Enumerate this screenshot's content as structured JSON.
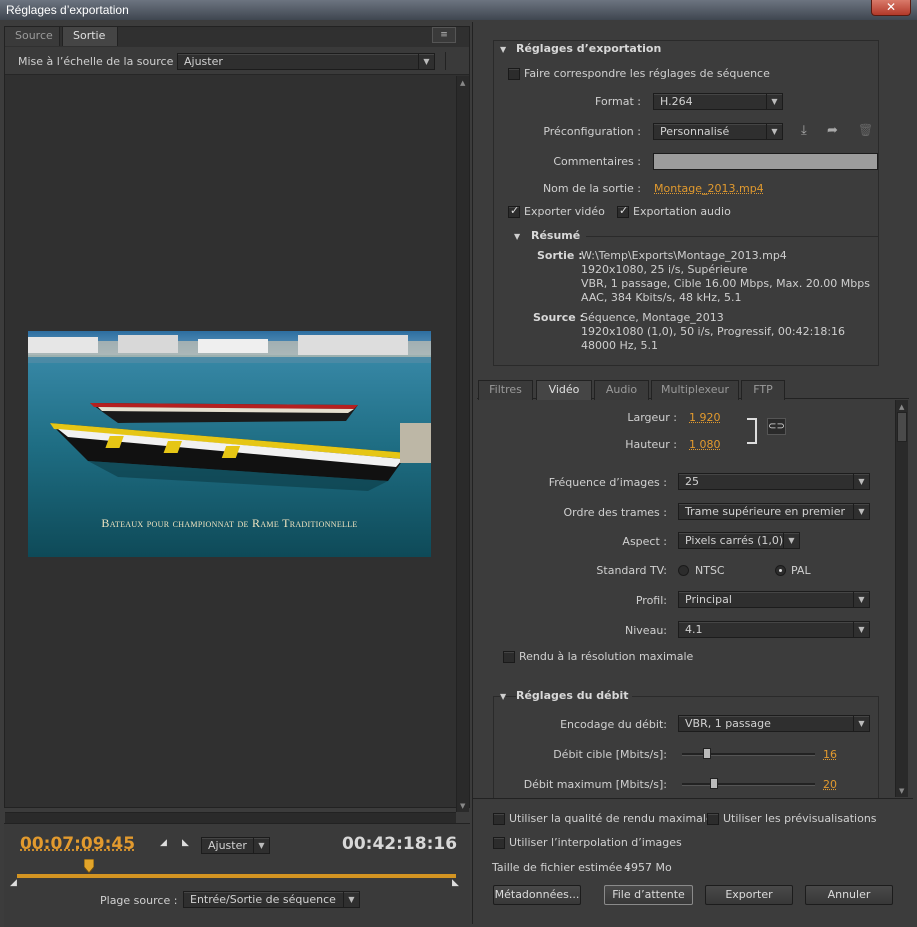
{
  "window": {
    "title": "Réglages d’exportation",
    "close": "✕"
  },
  "left": {
    "tabs": [
      "Source",
      "Sortie"
    ],
    "menu_icon": "≡",
    "scale_label": "Mise à l’échelle de la source :",
    "scale_value": "Ajuster",
    "caption": "Bateaux pour championnat de Rame Traditionnelle",
    "timecode_current": "00:07:09:45",
    "timecode_total": "00:42:18:16",
    "fit_value": "Ajuster",
    "range_label": "Plage source :",
    "range_value": "Entrée/Sortie de séquence",
    "playhead_fraction": 0.165
  },
  "export": {
    "section_title": "Réglages d’exportation",
    "match_seq": "Faire correspondre les réglages de séquence",
    "format_label": "Format :",
    "format_value": "H.264",
    "preset_label": "Préconfiguration :",
    "preset_value": "Personnalisé",
    "comments_label": "Commentaires :",
    "output_label": "Nom de la sortie :",
    "output_value": "Montage_2013.mp4",
    "export_video": "Exporter vidéo",
    "export_audio": "Exportation audio",
    "summary_title": "Résumé",
    "out_label": "Sortie :",
    "out_lines": [
      "W:\\Temp\\Exports\\Montage_2013.mp4",
      "1920x1080, 25 i/s, Supérieure",
      "VBR, 1 passage, Cible 16.00 Mbps, Max. 20.00 Mbps",
      "AAC, 384  Kbits/s, 48  kHz, 5.1"
    ],
    "src_label": "Source :",
    "src_lines": [
      "Séquence, Montage_2013",
      "1920x1080 (1,0), 50  i/s, Progressif, 00:42:18:16",
      "48000 Hz, 5.1"
    ]
  },
  "tabs": [
    "Filtres",
    "Vidéo",
    "Audio",
    "Multiplexeur",
    "FTP"
  ],
  "video": {
    "width_label": "Largeur :",
    "width_value": "1 920",
    "height_label": "Hauteur :",
    "height_value": "1 080",
    "fps_label": "Fréquence d’images :",
    "fps_value": "25",
    "field_label": "Ordre des trames :",
    "field_value": "Trame supérieure en premier",
    "aspect_label": "Aspect :",
    "aspect_value": "Pixels carrés (1,0)",
    "tv_label": "Standard TV:",
    "ntsc": "NTSC",
    "pal": "PAL",
    "profile_label": "Profil:",
    "profile_value": "Principal",
    "level_label": "Niveau:",
    "level_value": "4.1",
    "maxres": "Rendu à la résolution maximale",
    "bitrate_title": "Réglages du débit",
    "enc_label": "Encodage du débit:",
    "enc_value": "VBR, 1 passage",
    "target_label": "Débit cible [Mbits/s]:",
    "target_value": "16",
    "max_label": "Débit maximum [Mbits/s]:",
    "max_value": "20",
    "target_fraction": 0.19,
    "max_fraction": 0.24
  },
  "bottom": {
    "max_quality": "Utiliser la qualité de rendu maximale",
    "previews": "Utiliser les prévisualisations",
    "interp": "Utiliser l’interpolation d’images",
    "size_label": "Taille de fichier estimée :",
    "size_value": "4957 Mo",
    "metadata": "Métadonnées...",
    "queue": "File d’attente",
    "export": "Exporter",
    "cancel": "Annuler"
  }
}
